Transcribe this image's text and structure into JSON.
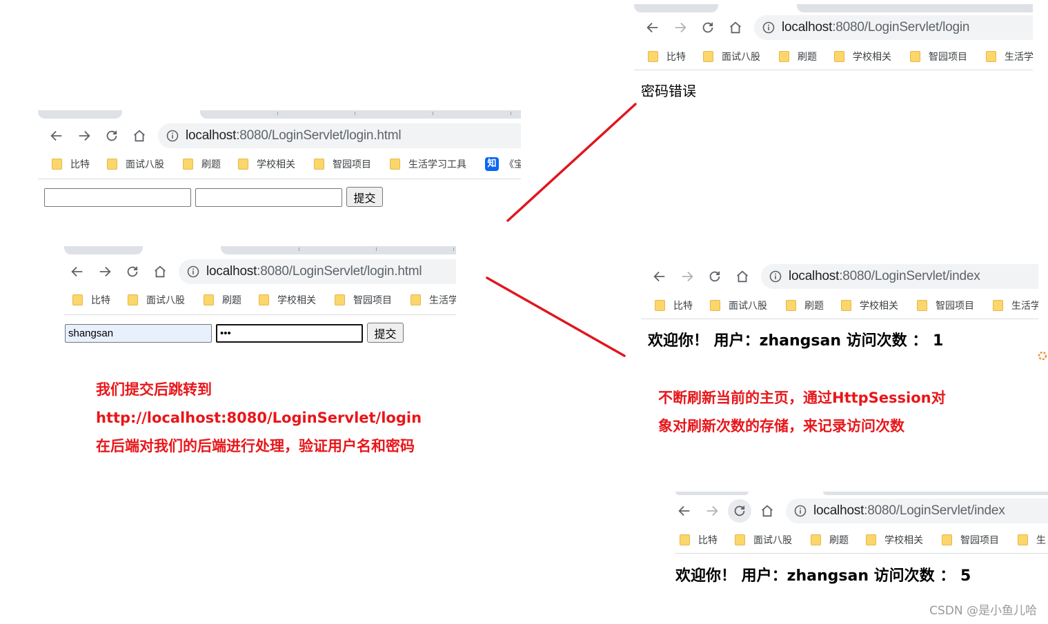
{
  "bookmarks_full": [
    "比特",
    "面试八股",
    "刷题",
    "学校相关",
    "智园项目",
    "生活学习工具"
  ],
  "screenshots": {
    "s1": {
      "url_host": "localhost",
      "url_path": ":8080/LoginServlet/login.html",
      "bookmarks": [
        "比特",
        "面试八股",
        "刷题",
        "学校相关",
        "智园项目",
        "生活学习工具"
      ],
      "zhihu_badge": "知",
      "bookmark_cut": "《宝",
      "username_value": "",
      "password_value": "",
      "submit_label": "提交"
    },
    "s2": {
      "url_host": "localhost",
      "url_path": ":8080/LoginServlet/login.html",
      "bookmarks": [
        "比特",
        "面试八股",
        "刷题",
        "学校相关",
        "智园项目",
        "生活学"
      ],
      "username_value": "shangsan",
      "password_value": "•••",
      "submit_label": "提交"
    },
    "s3": {
      "url_host": "localhost",
      "url_path": ":8080/LoginServlet/login",
      "bookmarks": [
        "比特",
        "面试八股",
        "刷题",
        "学校相关",
        "智园项目",
        "生活学"
      ],
      "message": "密码错误"
    },
    "s4": {
      "url_host": "localhost",
      "url_path": ":8080/LoginServlet/index",
      "bookmarks": [
        "比特",
        "面试八股",
        "刷题",
        "学校相关",
        "智园项目",
        "生活学"
      ],
      "welcome": "欢迎你！  用户：zhangsan 访问次数 ： 1"
    },
    "s5": {
      "url_host": "localhost",
      "url_path": ":8080/LoginServlet/index",
      "bookmarks": [
        "比特",
        "面试八股",
        "刷题",
        "学校相关",
        "智园项目",
        "生"
      ],
      "welcome": "欢迎你！  用户：zhangsan 访问次数 ： 5"
    }
  },
  "annotations": {
    "left": [
      "我们提交后跳转到",
      "http://localhost:8080/LoginServlet/login",
      "在后端对我们的后端进行处理，验证用户名和密码"
    ],
    "right": [
      "不断刷新当前的主页，通过HttpSession对",
      "象对刷新次数的存储，来记录访问次数"
    ]
  },
  "watermark": "CSDN @是小鱼儿哈",
  "colors": {
    "annotation": "#e8161a",
    "arrow": "#e0161f",
    "folder": "#fbd66b",
    "urlbar": "#f1f3f4",
    "tab": "#dee1e6"
  },
  "icons": [
    "back-arrow-icon",
    "forward-arrow-icon",
    "reload-icon",
    "home-icon",
    "info-icon",
    "folder-icon",
    "zhihu-icon",
    "loading-icon"
  ]
}
